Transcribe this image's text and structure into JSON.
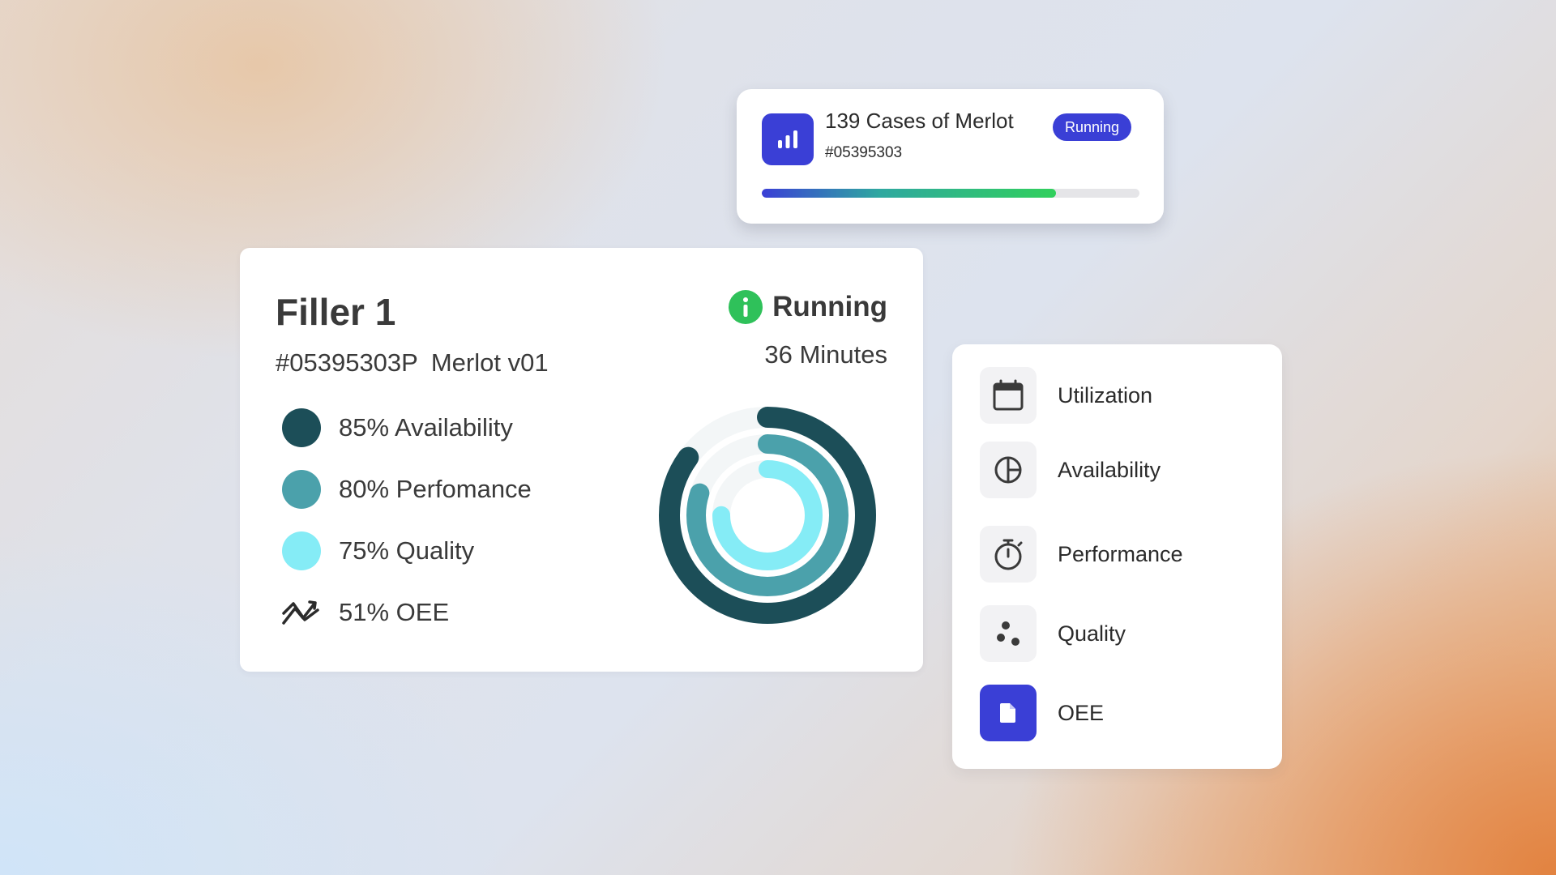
{
  "job": {
    "title": "139 Cases of Merlot",
    "id": "#05395303",
    "status": "Running",
    "progress_percent": 78,
    "icon": "bar-chart-icon"
  },
  "filler": {
    "title": "Filler 1",
    "batch_id": "#05395303P",
    "recipe": "Merlot v01",
    "status": "Running",
    "duration": "36 Minutes",
    "metrics": [
      {
        "label": "85% Availability",
        "value": 85,
        "color": "#1c4e58"
      },
      {
        "label": "80% Perfomance",
        "value": 80,
        "color": "#4ba1ab"
      },
      {
        "label": "75% Quality",
        "value": 75,
        "color": "#85ecf6"
      },
      {
        "label": "51% OEE",
        "value": 51,
        "icon": "trend-icon"
      }
    ]
  },
  "menu": {
    "items": [
      {
        "label": "Utilization",
        "icon": "calendar-icon",
        "active": false
      },
      {
        "label": "Availability",
        "icon": "pie-icon",
        "active": false
      },
      {
        "label": "Performance",
        "icon": "stopwatch-icon",
        "active": false
      },
      {
        "label": "Quality",
        "icon": "dots-icon",
        "active": false
      },
      {
        "label": "OEE",
        "icon": "document-icon",
        "active": true
      }
    ]
  },
  "colors": {
    "accent": "#3a3fd6",
    "running_green": "#2fc15a",
    "ring_track": "#f3f6f7"
  }
}
